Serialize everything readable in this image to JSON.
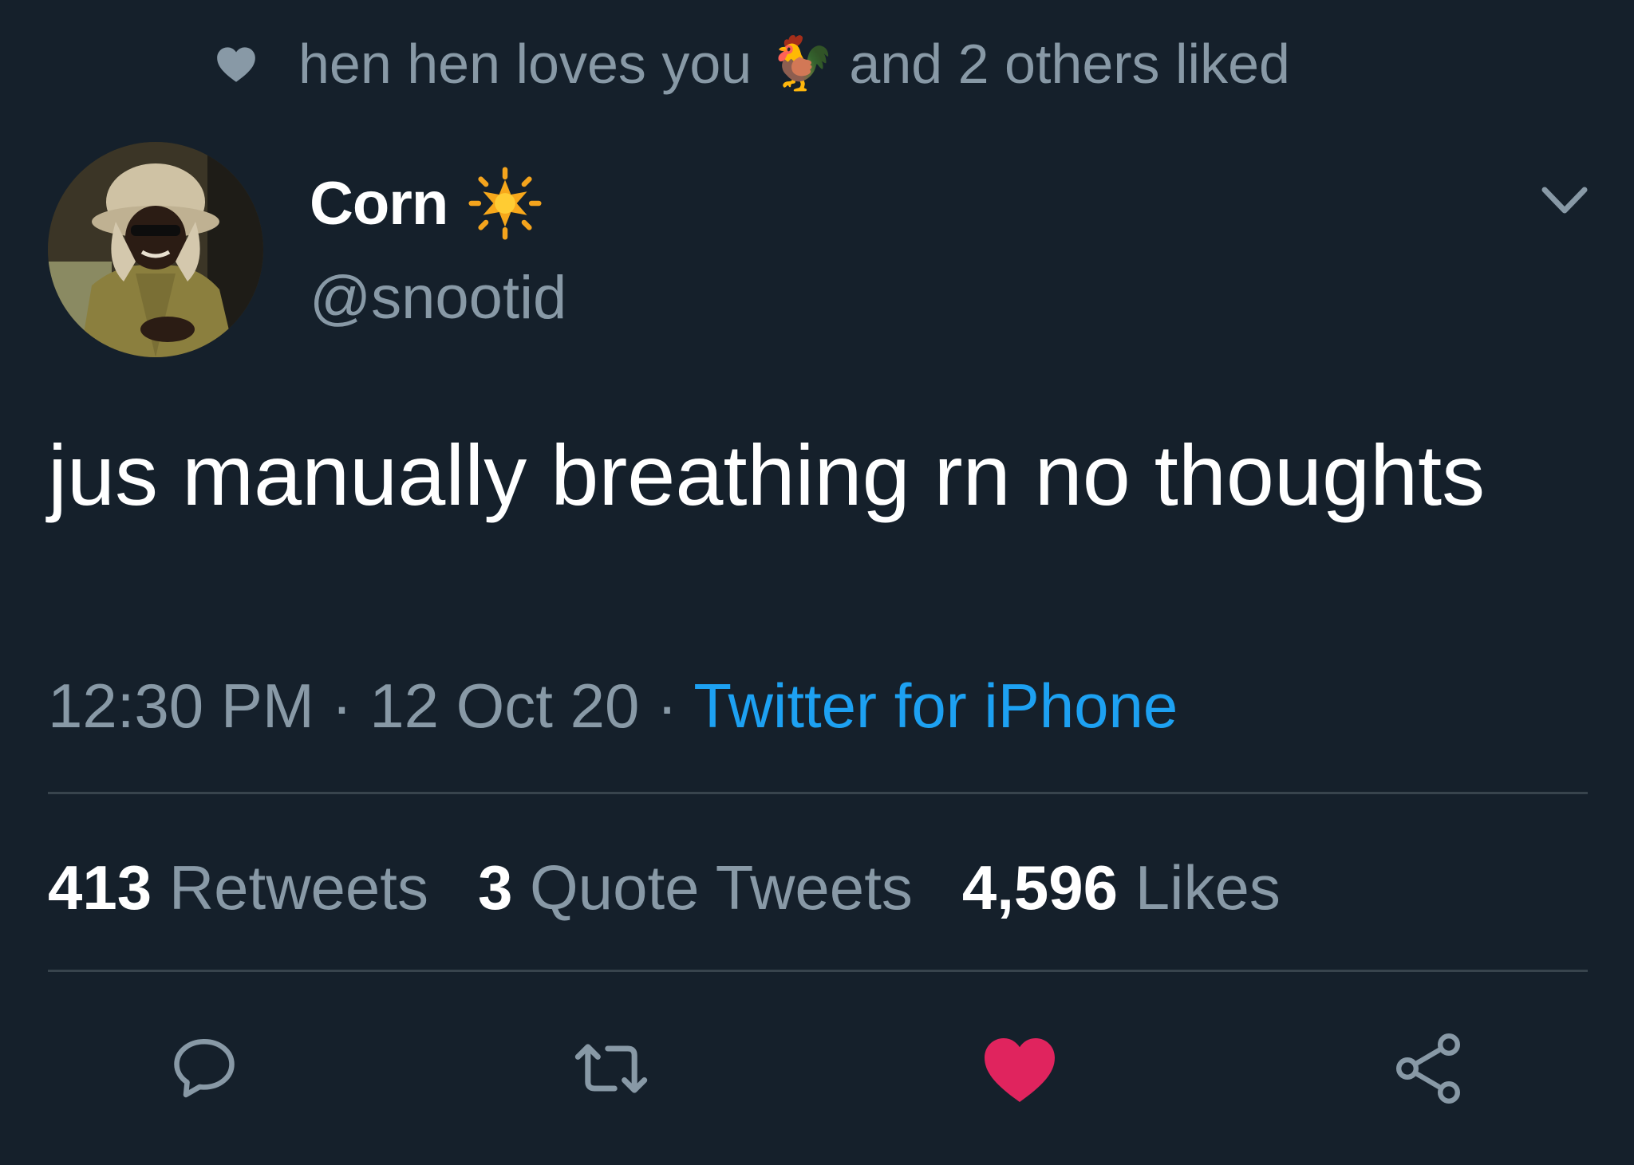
{
  "social_context": {
    "text_before": "hen hen loves you",
    "emoji": "🐓",
    "text_after": "and 2 others liked",
    "icon": "heart-icon"
  },
  "author": {
    "display_name": "Corn",
    "name_emoji": "sun-emoji",
    "handle": "@snootid"
  },
  "tweet": {
    "text": "jus manually breathing rn no thoughts",
    "time": "12:30 PM",
    "separator": " · ",
    "date": "12 Oct 20",
    "source": "Twitter for iPhone"
  },
  "stats": {
    "retweets_count": "413",
    "retweets_label": "Retweets",
    "quotes_count": "3",
    "quotes_label": "Quote Tweets",
    "likes_count": "4,596",
    "likes_label": "Likes"
  },
  "actions": {
    "reply_icon": "reply-icon",
    "retweet_icon": "retweet-icon",
    "like_icon": "heart-icon",
    "like_active": true,
    "share_icon": "share-icon"
  },
  "colors": {
    "background": "#15202b",
    "muted": "#8899a6",
    "link": "#1da1f2",
    "like": "#e0245e",
    "divider": "#38444d"
  }
}
